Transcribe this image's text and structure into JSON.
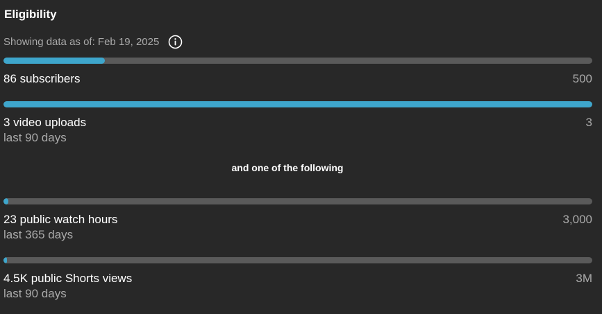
{
  "header": {
    "title": "Eligibility",
    "as_of": "Showing data as of: Feb 19, 2025",
    "info_icon": "info-icon"
  },
  "colors": {
    "background": "#282828",
    "progress_fill": "#3ea6cc",
    "progress_track": "#5a5a5a"
  },
  "requirements": [
    {
      "label": "86 subscribers",
      "target": "500",
      "period": "",
      "progress": 0.172
    },
    {
      "label": "3 video uploads",
      "target": "3",
      "period": "last 90 days",
      "progress": 1.0
    }
  ],
  "separator": "and one of the following",
  "alternatives": [
    {
      "label": "23 public watch hours",
      "target": "3,000",
      "period": "last 365 days",
      "progress": 0.0077
    },
    {
      "label": "4.5K public Shorts views",
      "target": "3M",
      "period": "last 90 days",
      "progress": 0.0015
    }
  ]
}
